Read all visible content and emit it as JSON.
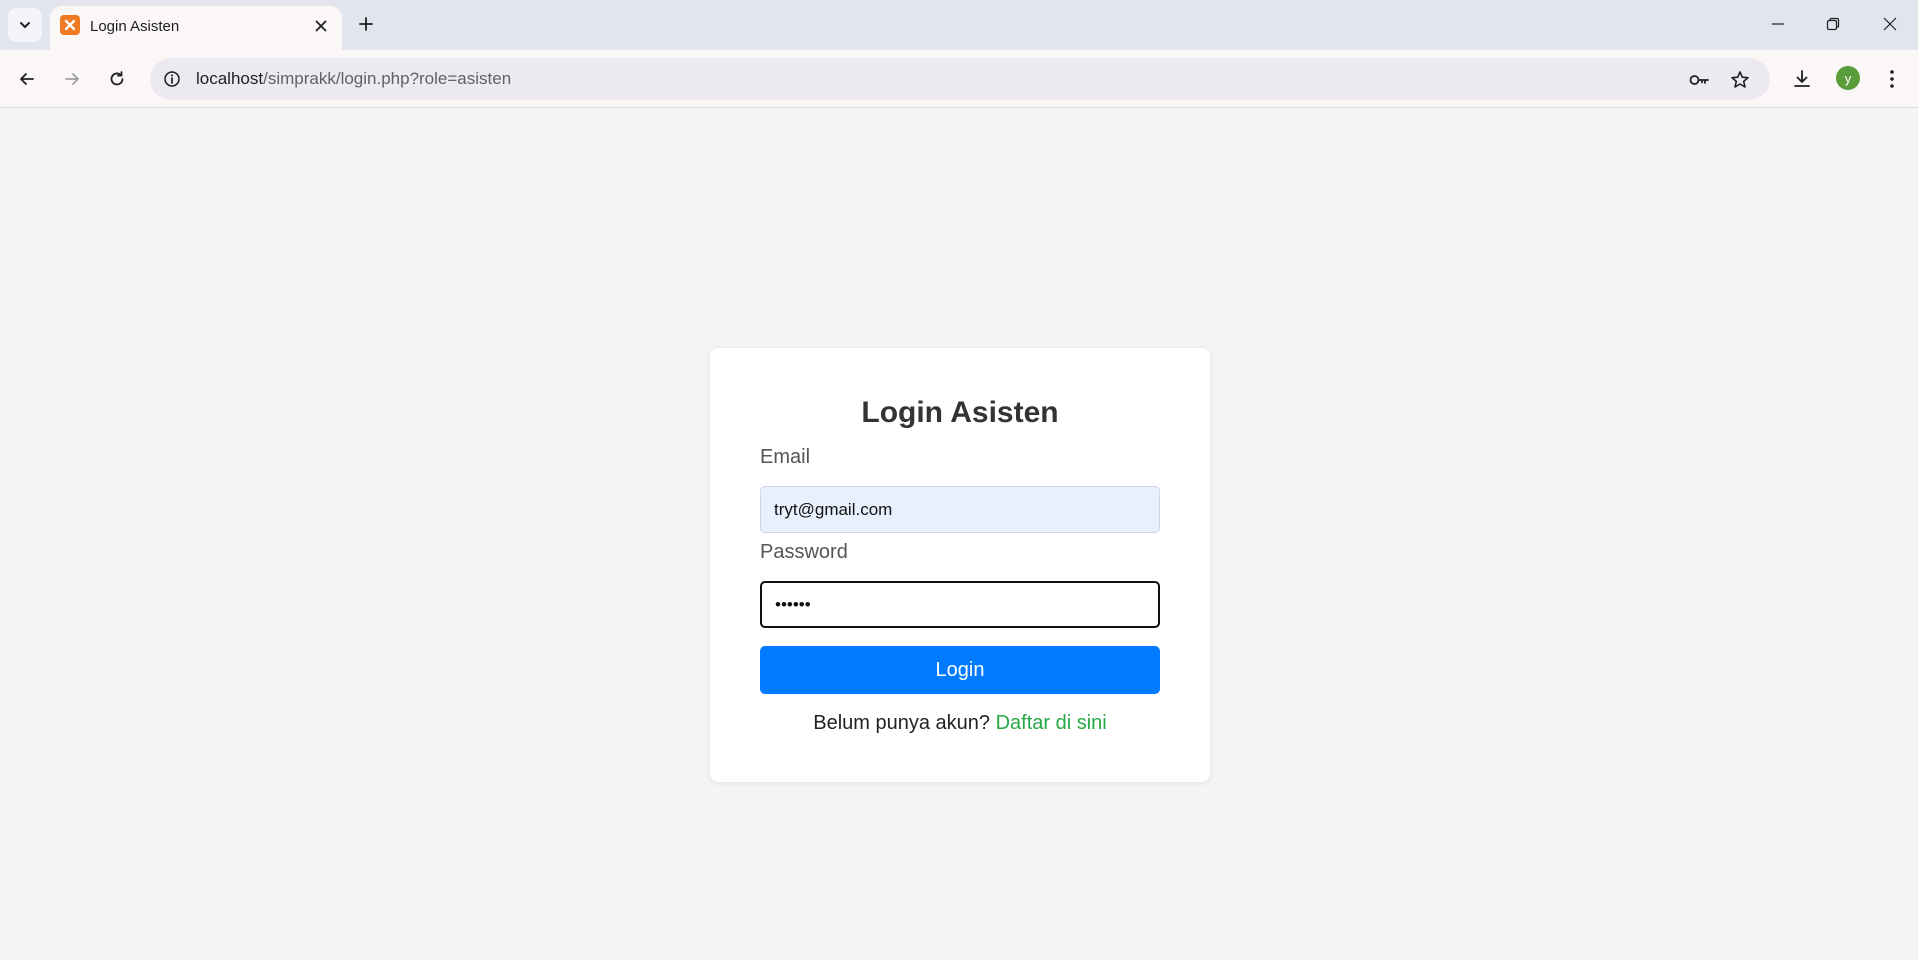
{
  "browser": {
    "tab_title": "Login Asisten",
    "url_host": "localhost",
    "url_path": "/simprakk/login.php?role=asisten",
    "profile_initial": "y"
  },
  "page": {
    "title": "Login Asisten",
    "email_label": "Email",
    "email_value": "tryt@gmail.com",
    "password_label": "Password",
    "password_value": "••••••",
    "login_button": "Login",
    "register_prompt": "Belum punya akun?",
    "register_link": "Daftar di sini"
  },
  "colors": {
    "primary_button": "#007bff",
    "link": "#28a745",
    "favicon": "#f07b22",
    "avatar": "#5a9c3a"
  }
}
